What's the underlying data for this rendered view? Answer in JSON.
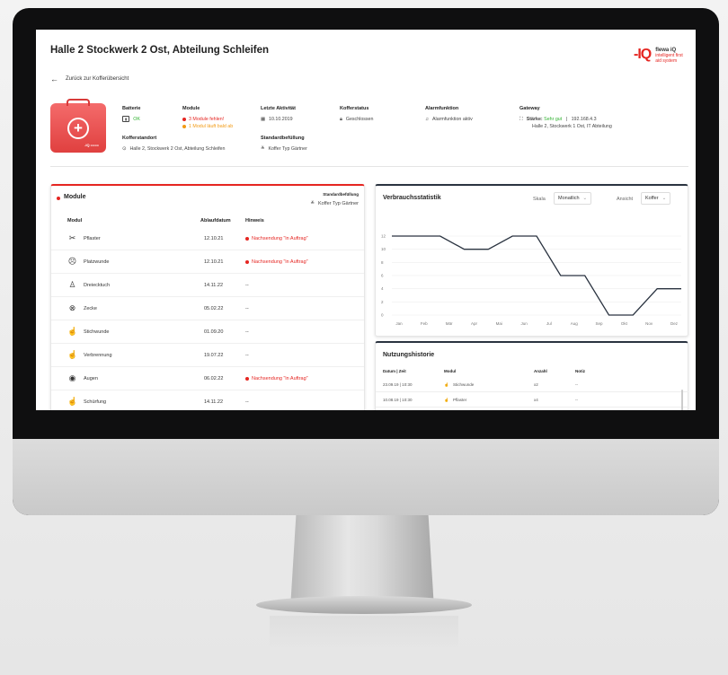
{
  "header": {
    "title": "Halle 2 Stockwerk 2 Ost, Abteilung Schleifen",
    "back_label": "Zurück zur Kofferübersicht",
    "logo": {
      "mark": "-IQ",
      "name": "flewa iQ",
      "line1": "intelligent first",
      "line2": "aid system"
    }
  },
  "case_badge": "-IQ ====",
  "info": {
    "batterie": {
      "label": "Batterie",
      "value": "OK"
    },
    "module": {
      "label": "Module",
      "error": "3 Module fehlen!",
      "warning": "1 Modul läuft bald ab"
    },
    "letzte_aktivitaet": {
      "label": "Letzte Aktivität",
      "value": "10.10.2019"
    },
    "kofferstatus": {
      "label": "Kofferstatus",
      "value": "Geschlossen"
    },
    "alarmfunktion": {
      "label": "Alarmfunktion",
      "value": "Alarmfunktion aktiv"
    },
    "gateway": {
      "label": "Gateway",
      "strength_label": "Stärke:",
      "strength_value": "Sehr gut",
      "separator": "|",
      "ip": "192.168.4.3",
      "location": "Halle 2, Stockwerk 1 Ost, IT Abteilung"
    },
    "kofferstandort": {
      "label": "Kofferstandort",
      "value": "Halle 2, Stockwerk 2 Ost, Abteilung Schleifen"
    },
    "standardbefuellung": {
      "label": "Standardbefüllung",
      "value": "Koffer Typ Gärtner"
    }
  },
  "modules_panel": {
    "title": "Module",
    "std_label": "Standardbefüllung",
    "std_value": "Koffer Typ Gärtner",
    "columns": [
      "Modul",
      "Ablaufdatum",
      "Hinweis"
    ],
    "rows": [
      {
        "icon": "bandage-icon",
        "glyph": "✂",
        "name": "Pflaster",
        "date": "12.10.21",
        "note": "Nachsendung \"in Auftrag\"",
        "alert": true
      },
      {
        "icon": "wound-icon",
        "glyph": "☹",
        "name": "Platzwunde",
        "date": "12.10.21",
        "note": "Nachsendung \"in Auftrag\"",
        "alert": true
      },
      {
        "icon": "sling-icon",
        "glyph": "♙",
        "name": "Dreiecktuch",
        "date": "14.11.22",
        "note": "--",
        "alert": false
      },
      {
        "icon": "tick-icon",
        "glyph": "⊗",
        "name": "Zecke",
        "date": "05.02.22",
        "note": "--",
        "alert": false
      },
      {
        "icon": "stab-wound-icon",
        "glyph": "☝",
        "name": "Stichwunde",
        "date": "01.09.20",
        "note": "--",
        "alert": false
      },
      {
        "icon": "burn-icon",
        "glyph": "☝",
        "name": "Verbrennung",
        "date": "19.07.22",
        "note": "--",
        "alert": false
      },
      {
        "icon": "eye-icon",
        "glyph": "◉",
        "name": "Augen",
        "date": "06.02.22",
        "note": "Nachsendung \"in Auftrag\"",
        "alert": true
      },
      {
        "icon": "abrasion-icon",
        "glyph": "☝",
        "name": "Schürfung",
        "date": "14.11.22",
        "note": "--",
        "alert": false
      }
    ]
  },
  "stats_panel": {
    "title": "Verbrauchsstatistik",
    "skala_label": "Skala",
    "skala_value": "Monatlich",
    "ansicht_label": "Ansicht",
    "ansicht_value": "Koffer"
  },
  "chart_data": {
    "type": "line",
    "categories": [
      "Jan",
      "Feb",
      "Mär",
      "Apr",
      "Mai",
      "Jun",
      "Jul",
      "Aug",
      "Sep",
      "Okt",
      "Nov",
      "Dez"
    ],
    "series": [
      {
        "values": [
          12,
          12,
          12,
          10,
          10,
          12,
          12,
          6,
          6,
          0,
          0,
          4,
          4
        ]
      }
    ],
    "yticks": [
      0,
      2,
      4,
      6,
      8,
      10,
      12
    ],
    "ylim": [
      0,
      12
    ],
    "color": "#2a3340",
    "grid": true
  },
  "history_panel": {
    "title": "Nutzungshistorie",
    "columns": [
      "Datum | Zeit",
      "Modul",
      "Anzahl",
      "Notiz"
    ],
    "rows": [
      {
        "date": "23.09.19 | 10:30",
        "icon": "stab-wound-icon",
        "modul": "Stichwunde",
        "count": "x2",
        "note": "--"
      },
      {
        "date": "10.08.19 | 10:30",
        "icon": "bandage-icon",
        "modul": "Pflaster",
        "count": "x4",
        "note": "--"
      }
    ]
  }
}
